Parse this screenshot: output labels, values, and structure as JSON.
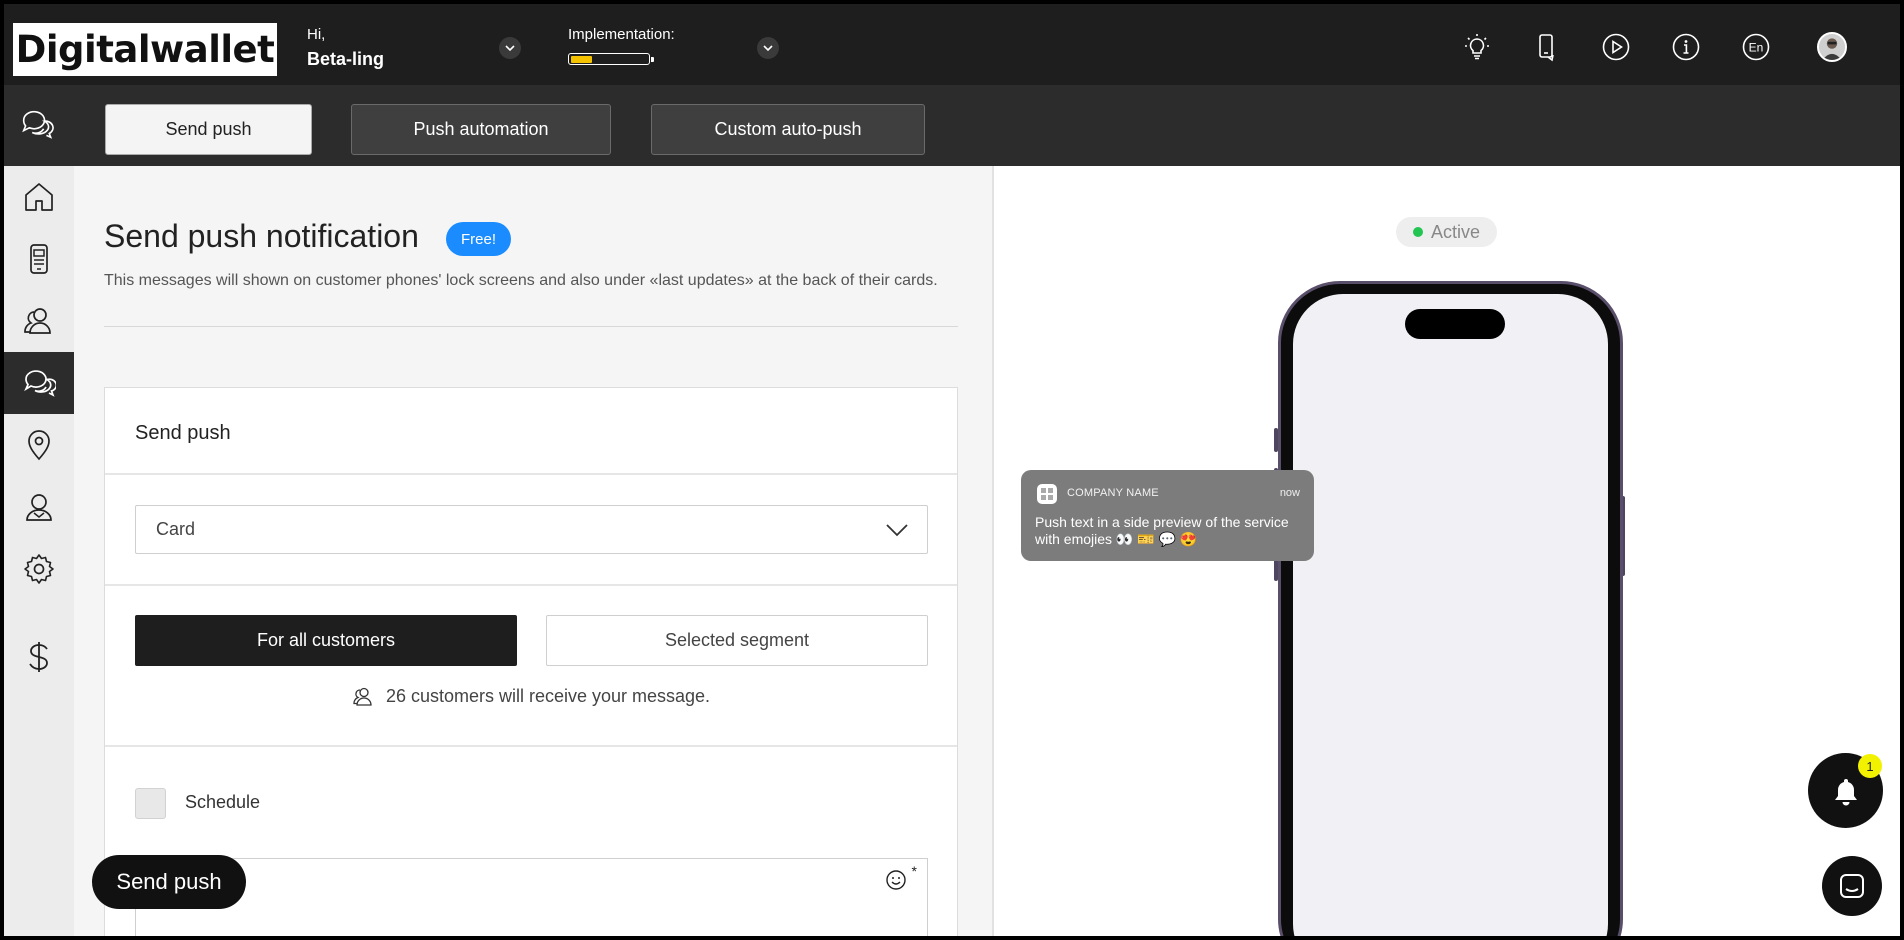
{
  "brand": {
    "logo": "Digitalwallet",
    "accent": "#1a8cff",
    "progress_color": "#f5c200"
  },
  "header": {
    "greeting": "Hi,",
    "user_name": "Beta-ling",
    "implementation_label": "Implementation:",
    "implementation_progress": 0.28,
    "icons": [
      "lightbulb-icon",
      "phone-icon",
      "play-icon",
      "info-icon",
      "language-icon",
      "avatar"
    ],
    "language": "En"
  },
  "tabs": {
    "send_push": "Send push",
    "push_automation": "Push automation",
    "custom_auto_push": "Custom auto-push"
  },
  "sidebar": {
    "items": [
      "home-icon",
      "card-icon",
      "customers-icon",
      "messages-icon",
      "location-icon",
      "profile-icon",
      "settings-icon",
      "billing-icon"
    ],
    "active": "messages-icon"
  },
  "main": {
    "title": "Send push notification",
    "badge": "Free!",
    "subtitle": "This messages will shown on customer phones' lock screens and also under «last updates» at the back of their cards.",
    "form": {
      "card_title": "Send push",
      "select_value": "Card",
      "audience_all": "For all customers",
      "audience_segment": "Selected segment",
      "reach_text": "26 customers will receive your message.",
      "schedule_label": "Schedule",
      "required_mark": "*"
    },
    "send_button": "Send push"
  },
  "preview": {
    "status": "Active",
    "status_color": "#23c552",
    "notification": {
      "company": "COMPANY NAME",
      "time": "now",
      "text": "Push text in a side preview of the service with emojies 👀 🎫 💬 😍"
    }
  },
  "widgets": {
    "bell_count": "1"
  }
}
